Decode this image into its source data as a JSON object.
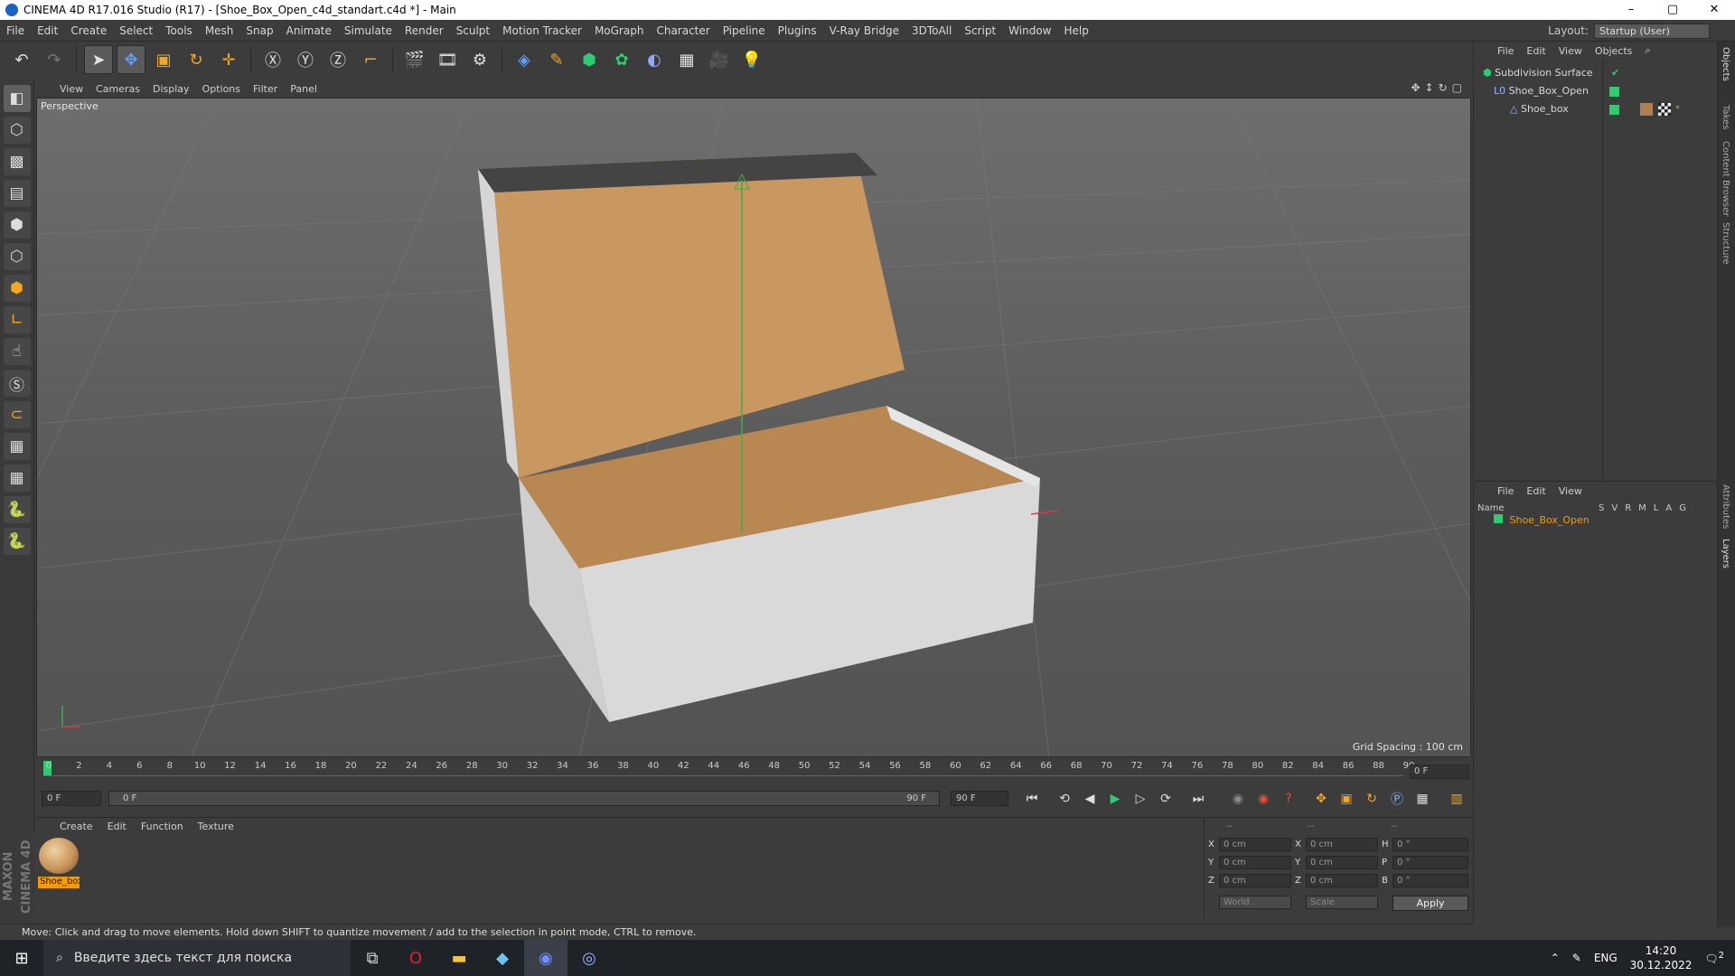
{
  "window": {
    "title": "CINEMA 4D R17.016 Studio (R17) - [Shoe_Box_Open_c4d_standart.c4d *] - Main",
    "minimize": "–",
    "maximize": "▢",
    "close": "✕"
  },
  "menu": [
    "File",
    "Edit",
    "Create",
    "Select",
    "Tools",
    "Mesh",
    "Snap",
    "Animate",
    "Simulate",
    "Render",
    "Sculpt",
    "Motion Tracker",
    "MoGraph",
    "Character",
    "Pipeline",
    "Plugins",
    "V-Ray Bridge",
    "3DToAll",
    "Script",
    "Window",
    "Help"
  ],
  "layout": {
    "label": "Layout:",
    "value": "Startup (User)"
  },
  "viewport": {
    "menu": [
      "View",
      "Cameras",
      "Display",
      "Options",
      "Filter",
      "Panel"
    ],
    "label": "Perspective",
    "grid_spacing": "Grid Spacing : 100 cm"
  },
  "timeline": {
    "ticks": [
      "0",
      "2",
      "4",
      "6",
      "8",
      "10",
      "12",
      "14",
      "16",
      "18",
      "20",
      "22",
      "24",
      "26",
      "28",
      "30",
      "32",
      "34",
      "36",
      "38",
      "40",
      "42",
      "44",
      "46",
      "48",
      "50",
      "52",
      "54",
      "56",
      "58",
      "60",
      "62",
      "64",
      "66",
      "68",
      "70",
      "72",
      "74",
      "76",
      "78",
      "80",
      "82",
      "84",
      "86",
      "88",
      "90"
    ],
    "current_frame": "0 F",
    "start": "0 F",
    "range_start": "0 F",
    "range_end": "90 F",
    "end": "90 F"
  },
  "material": {
    "menu": [
      "Create",
      "Edit",
      "Function",
      "Texture"
    ],
    "name": "Shoe_box"
  },
  "coords": {
    "header": [
      "--",
      "--",
      "--"
    ],
    "x": "0 cm",
    "y": "0 cm",
    "z": "0 cm",
    "sx": "0 cm",
    "sy": "0 cm",
    "sz": "0 cm",
    "h": "0 °",
    "p": "0 °",
    "b": "0 °",
    "lx": "X",
    "ly": "Y",
    "lz": "Z",
    "lh": "H",
    "lp": "P",
    "lb": "B",
    "mode": "World",
    "scale": "Scale",
    "apply": "Apply"
  },
  "status": "Move: Click and drag to move elements. Hold down SHIFT to quantize movement / add to the selection in point mode, CTRL to remove.",
  "objects": {
    "menu": [
      "File",
      "Edit",
      "View",
      "Objects"
    ],
    "items": [
      {
        "name": "Subdivision Surface"
      },
      {
        "name": "Shoe_Box_Open"
      },
      {
        "name": "Shoe_box"
      }
    ]
  },
  "layers": {
    "menu": [
      "File",
      "Edit",
      "View"
    ],
    "columns": [
      "Name",
      "S",
      "V",
      "R",
      "M",
      "L",
      "A",
      "G"
    ],
    "items": [
      {
        "name": "Shoe_Box_Open"
      }
    ]
  },
  "sidetabs": [
    "Objects",
    "Takes",
    "Content Browser",
    "Structure",
    "Attributes",
    "Layers"
  ],
  "taskbar": {
    "search_placeholder": "Введите здесь текст для поиска",
    "lang": "ENG",
    "time": "14:20",
    "date": "30.12.2022",
    "notif": "2"
  },
  "colors": {
    "accent": "#f39c00",
    "layer_green": "#2ecc71",
    "bg": "#3c3c3c"
  }
}
